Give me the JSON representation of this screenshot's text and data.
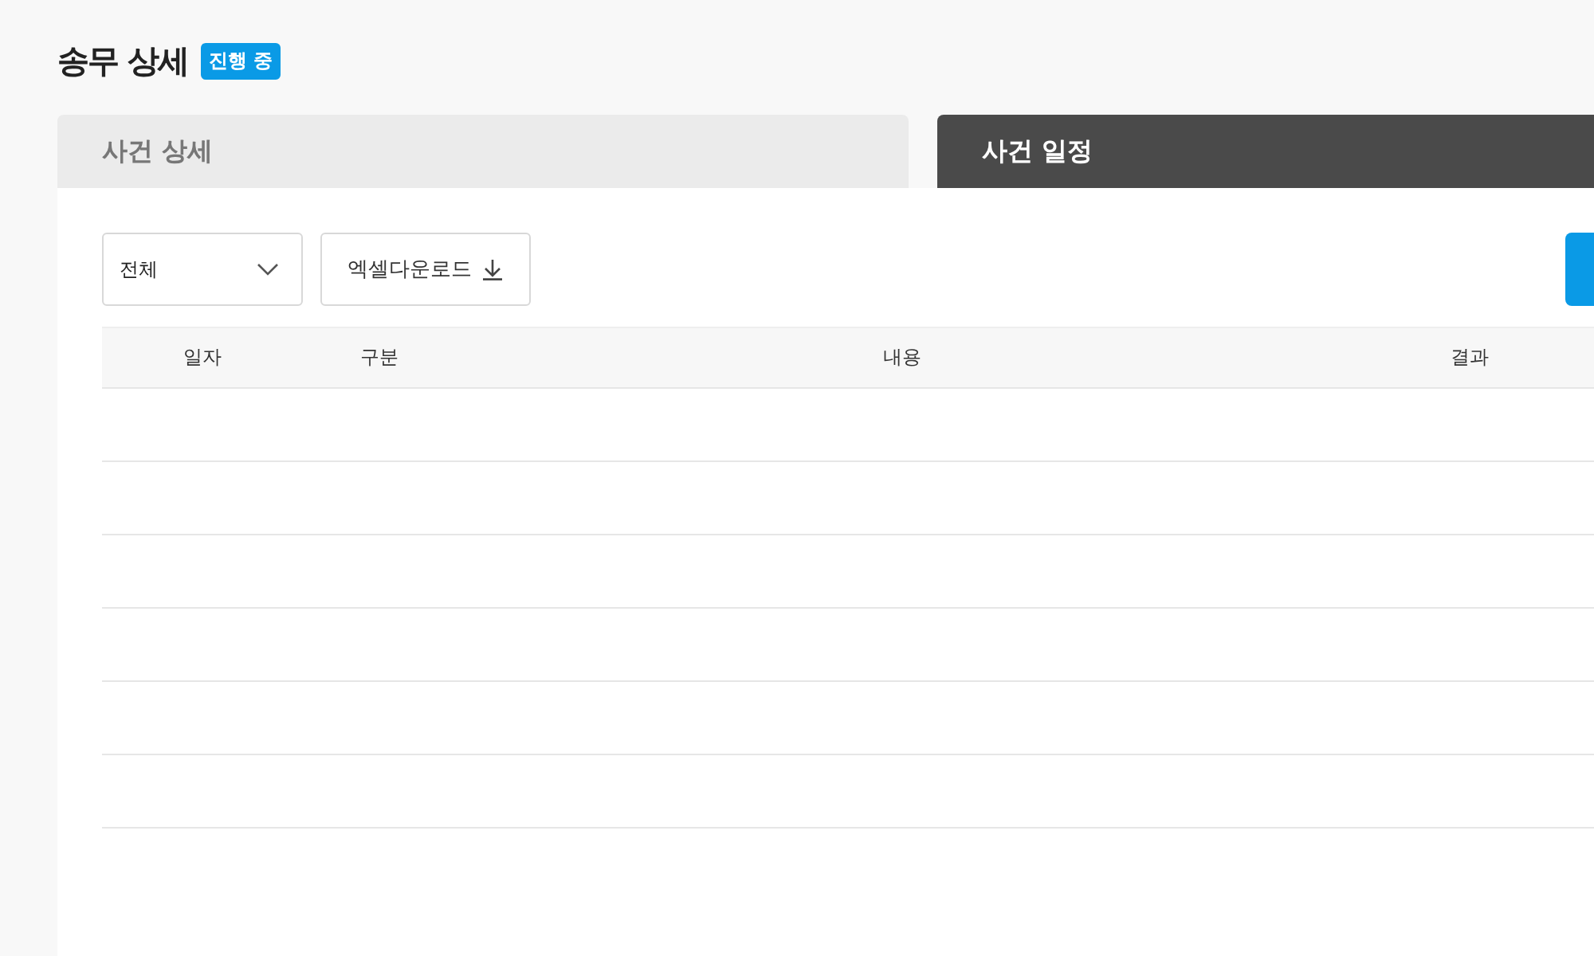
{
  "page": {
    "title": "송무 상세",
    "status_badge": "진행 중"
  },
  "tabs": [
    {
      "label": "사건 상세",
      "selected": false
    },
    {
      "label": "사건 일정",
      "selected": true
    }
  ],
  "toolbar": {
    "filter_dropdown": {
      "value": "전체"
    },
    "excel_download_button": "엑셀다운로드"
  },
  "table": {
    "columns": [
      "일자",
      "구분",
      "내용",
      "결과"
    ]
  }
}
